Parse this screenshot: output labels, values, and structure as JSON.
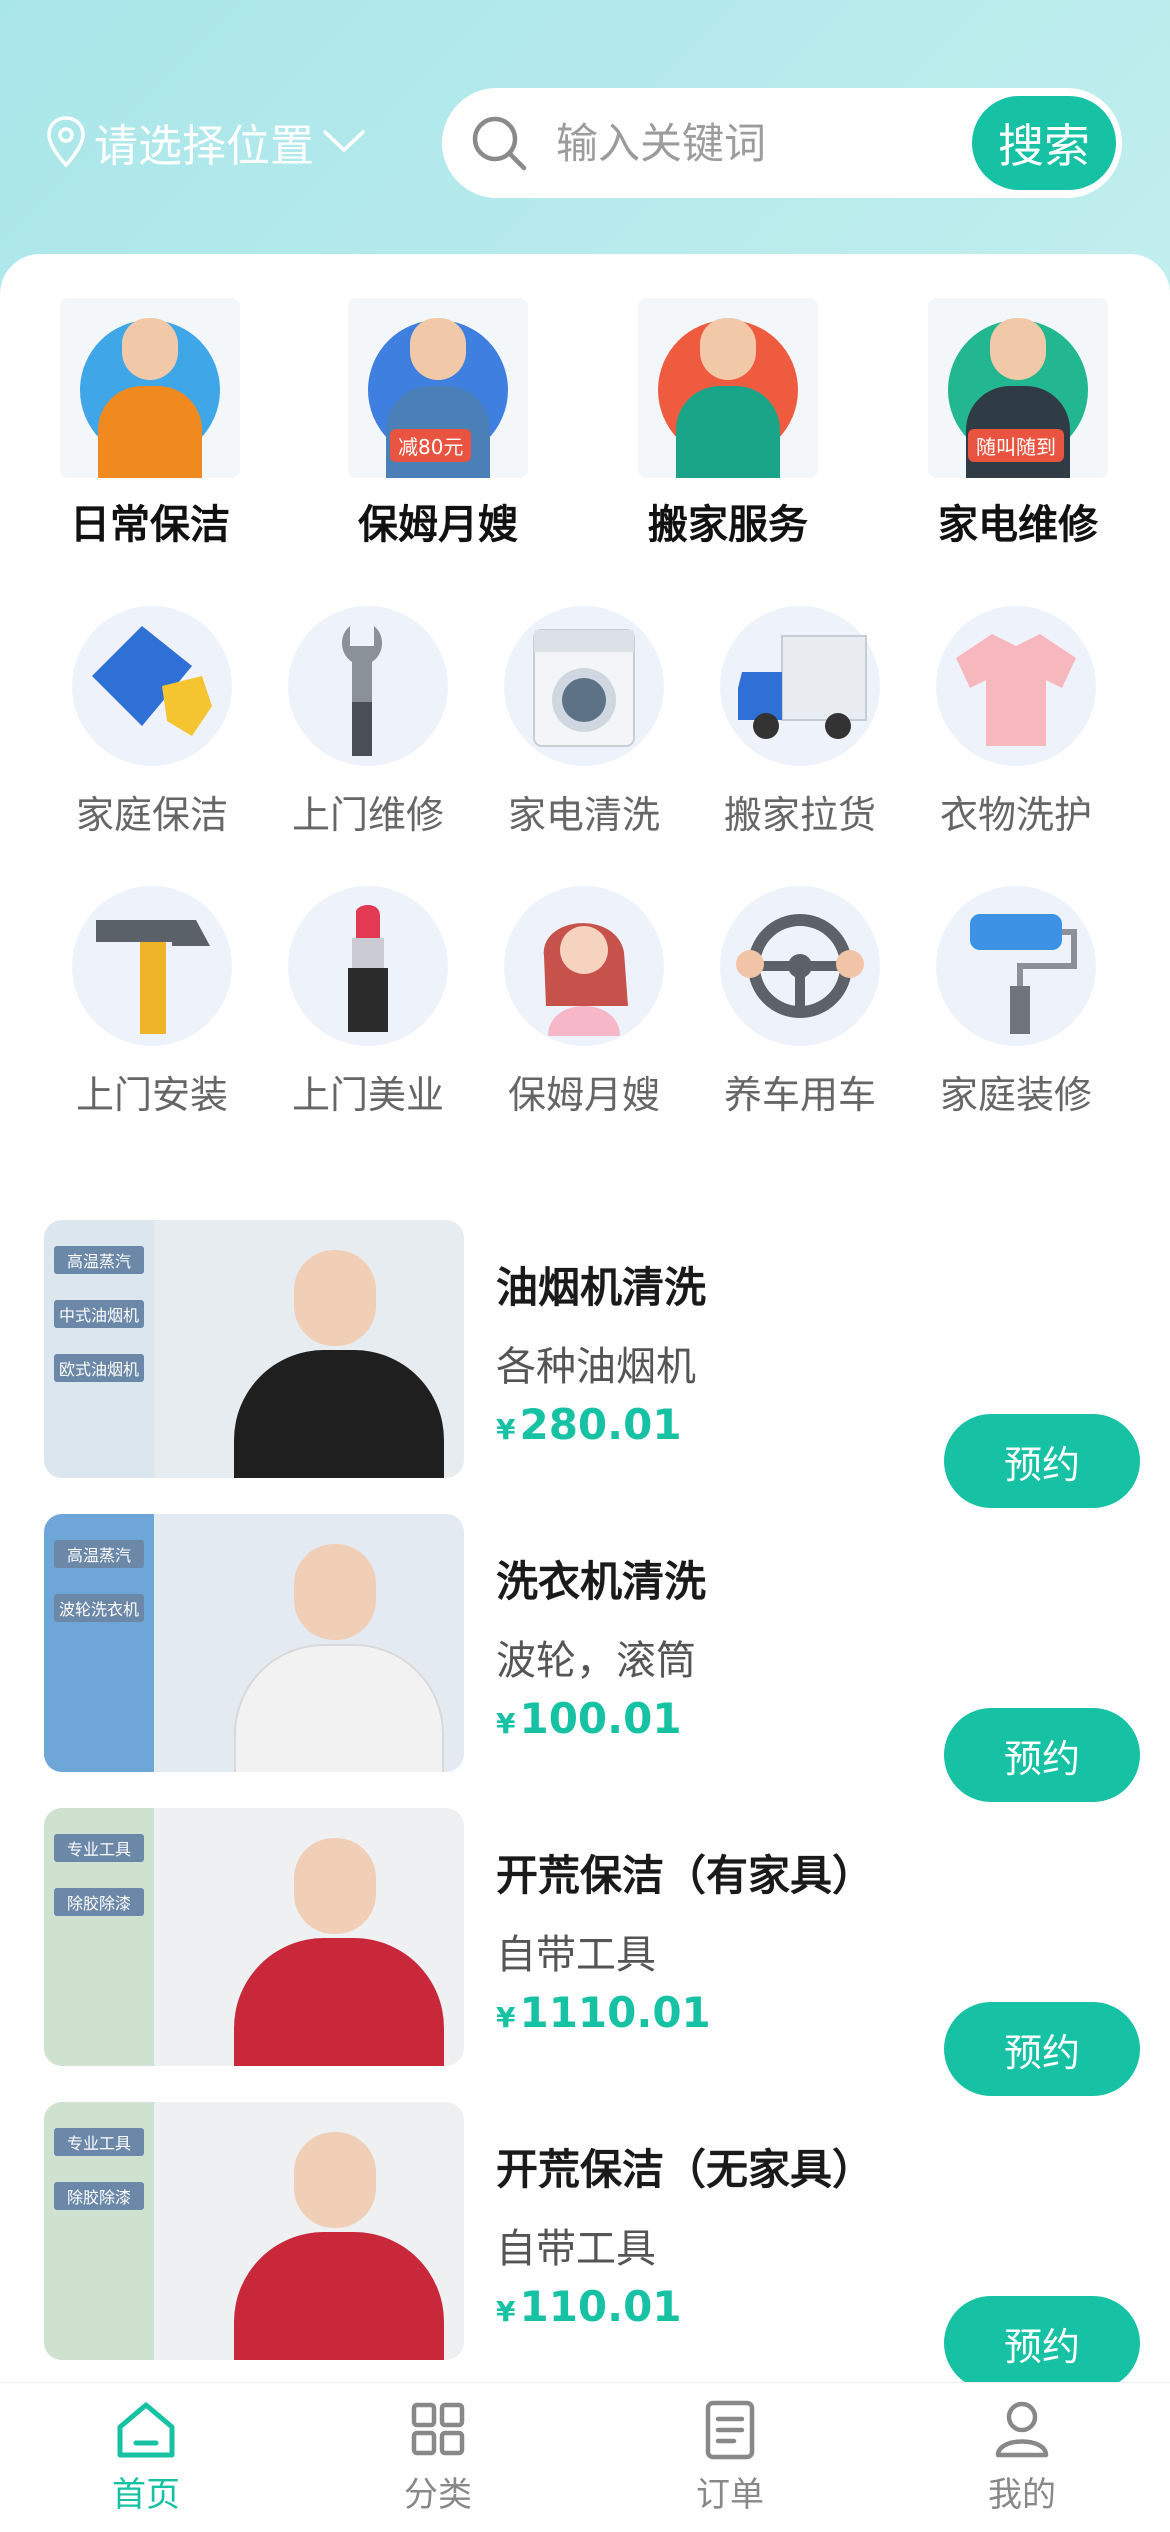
{
  "header": {
    "location_label": "请选择位置",
    "search_placeholder": "输入关键词",
    "search_button": "搜索"
  },
  "features": [
    {
      "label": "日常保洁",
      "icon": "cleaner-portrait",
      "badge": ""
    },
    {
      "label": "保姆月嫂",
      "icon": "nanny-portrait",
      "badge": "减80元"
    },
    {
      "label": "搬家服务",
      "icon": "mover-portrait",
      "badge": ""
    },
    {
      "label": "家电维修",
      "icon": "repair-portrait",
      "badge": "随叫随到"
    }
  ],
  "categories": [
    {
      "label": "家庭保洁",
      "icon": "cloth-glove-icon"
    },
    {
      "label": "上门维修",
      "icon": "wrench-icon"
    },
    {
      "label": "家电清洗",
      "icon": "washing-machine-icon"
    },
    {
      "label": "搬家拉货",
      "icon": "truck-icon"
    },
    {
      "label": "衣物洗护",
      "icon": "shirt-icon"
    },
    {
      "label": "上门安装",
      "icon": "hammer-icon"
    },
    {
      "label": "上门美业",
      "icon": "lipstick-icon"
    },
    {
      "label": "保姆月嫂",
      "icon": "mother-baby-icon"
    },
    {
      "label": "养车用车",
      "icon": "steering-wheel-icon"
    },
    {
      "label": "家庭装修",
      "icon": "paint-roller-icon"
    }
  ],
  "services": [
    {
      "title": "油烟机清洗",
      "desc": "各种油烟机",
      "currency": "¥",
      "price": "280.01",
      "button": "预约",
      "thumb_tags": [
        "高温蒸汽",
        "中式油烟机",
        "欧式油烟机"
      ],
      "accent": "#1f1f1f"
    },
    {
      "title": "洗衣机清洗",
      "desc": "波轮，滚筒",
      "currency": "¥",
      "price": "100.01",
      "button": "预约",
      "thumb_tags": [
        "高温蒸汽",
        "波轮洗衣机"
      ],
      "accent": "#f2f2f2"
    },
    {
      "title": "开荒保洁（有家具）",
      "desc": "自带工具",
      "currency": "¥",
      "price": "1110.01",
      "button": "预约",
      "thumb_tags": [
        "专业工具",
        "除胶除漆"
      ],
      "accent": "#c8283a"
    },
    {
      "title": "开荒保洁（无家具）",
      "desc": "自带工具",
      "currency": "¥",
      "price": "110.01",
      "button": "预约",
      "thumb_tags": [
        "专业工具",
        "除胶除漆"
      ],
      "accent": "#c8283a"
    }
  ],
  "tabs": [
    {
      "label": "首页",
      "icon": "home-icon",
      "active": true
    },
    {
      "label": "分类",
      "icon": "grid-icon",
      "active": false
    },
    {
      "label": "订单",
      "icon": "clipboard-icon",
      "active": false
    },
    {
      "label": "我的",
      "icon": "user-icon",
      "active": false
    }
  ],
  "colors": {
    "accent": "#16c2a3",
    "header_gradient_start": "#a9e6ea",
    "header_gradient_end": "#dcf5ec"
  }
}
